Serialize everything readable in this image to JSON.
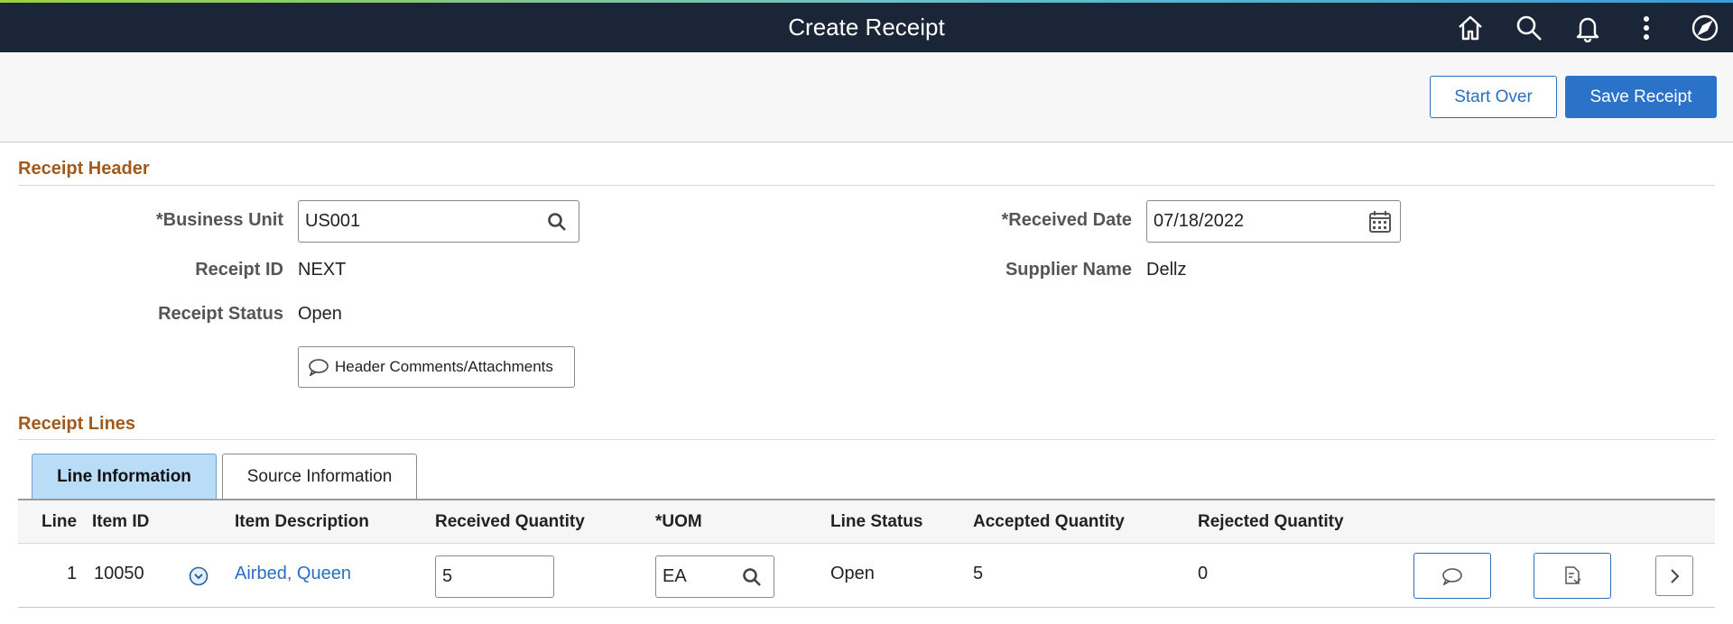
{
  "banner": {
    "title": "Create Receipt",
    "icons": [
      "home-icon",
      "search-icon",
      "bell-icon",
      "more-vertical-icon",
      "compass-icon"
    ]
  },
  "toolbar": {
    "start_over_label": "Start Over",
    "save_receipt_label": "Save Receipt"
  },
  "receipt_header": {
    "section_title": "Receipt Header",
    "business_unit": {
      "label": "*Business Unit",
      "value": "US001"
    },
    "received_date": {
      "label": "*Received Date",
      "value": "07/18/2022"
    },
    "receipt_id": {
      "label": "Receipt ID",
      "value": "NEXT"
    },
    "supplier_name": {
      "label": "Supplier Name",
      "value": "Dellz"
    },
    "receipt_status": {
      "label": "Receipt Status",
      "value": "Open"
    },
    "comments_button_label": "Header Comments/Attachments"
  },
  "receipt_lines": {
    "section_title": "Receipt Lines",
    "tabs": [
      {
        "label": "Line Information",
        "active": true
      },
      {
        "label": "Source Information",
        "active": false
      }
    ],
    "columns": {
      "line": "Line",
      "item_id": "Item ID",
      "item_description": "Item Description",
      "received_quantity": "Received Quantity",
      "uom": "*UOM",
      "line_status": "Line Status",
      "accepted_quantity": "Accepted Quantity",
      "rejected_quantity": "Rejected Quantity"
    },
    "rows": [
      {
        "line": "1",
        "item_id": "10050",
        "item_description": "Airbed, Queen",
        "received_quantity": "5",
        "uom": "EA",
        "line_status": "Open",
        "accepted_quantity": "5",
        "rejected_quantity": "0"
      }
    ]
  },
  "colors": {
    "banner_bg": "#1a2537",
    "section_title": "#a25a1c",
    "primary_button": "#2b73c9",
    "link": "#2a6fbd",
    "active_tab": "#b9dcf7"
  }
}
